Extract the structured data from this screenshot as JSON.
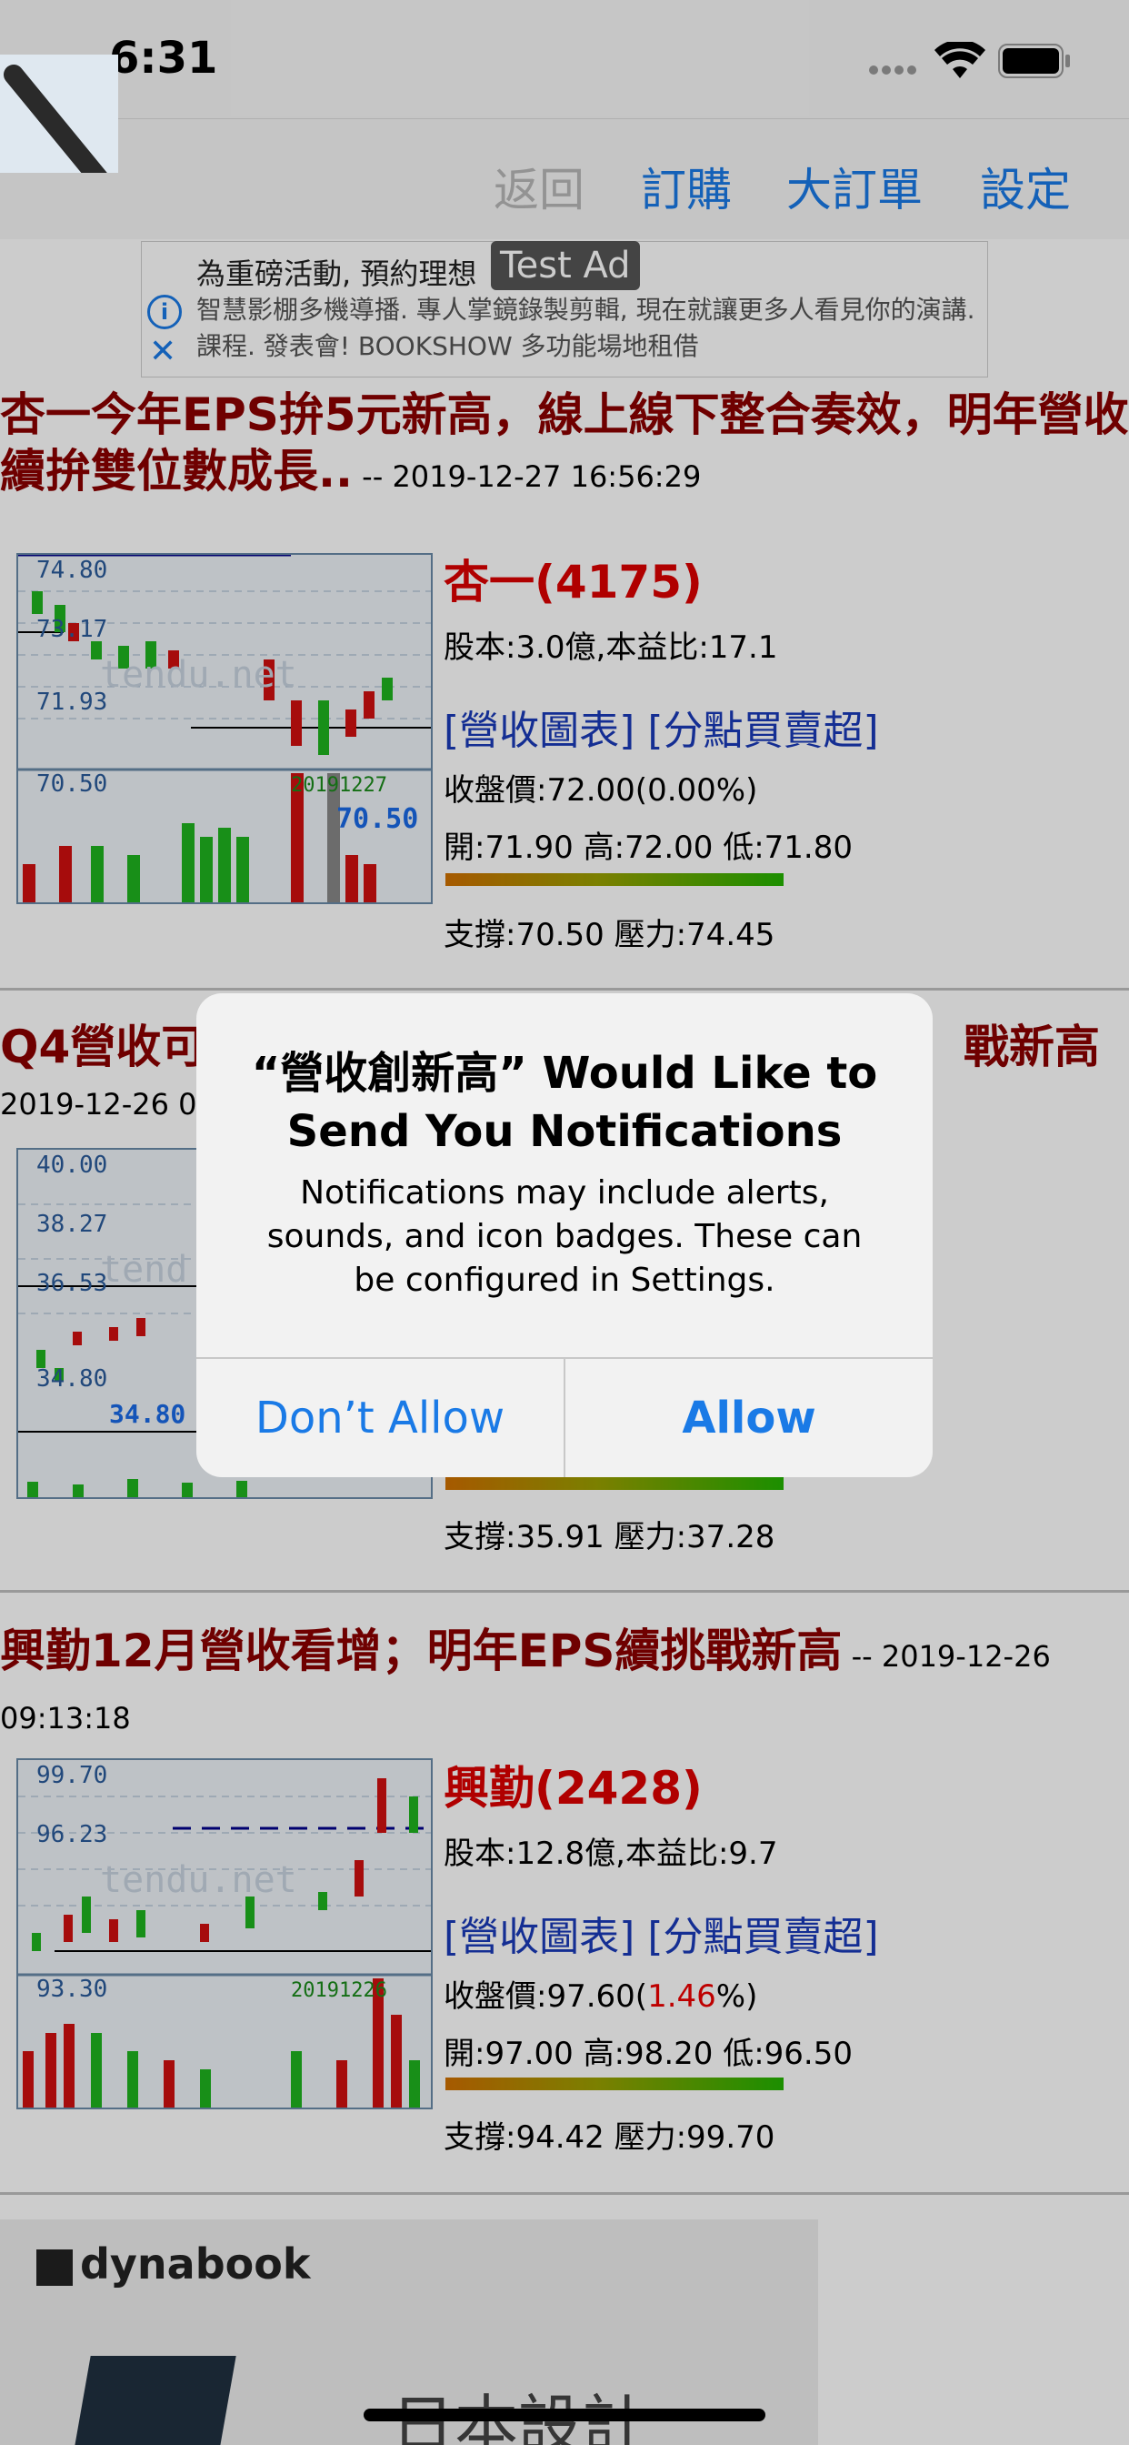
{
  "status_bar": {
    "time": "6:31"
  },
  "nav": {
    "back": "返回",
    "subscribe": "訂購",
    "big_orders": "大訂單",
    "settings": "設定"
  },
  "ad": {
    "title": "為重磅活動, 預約理想",
    "badge": "Test Ad",
    "body": "智慧影棚多機導播. 專人掌鏡錄製剪輯, 現在就讓更多人看見你的演講. 課程. 發表會! BOOKSHOW 多功能場地租借"
  },
  "articles": [
    {
      "headline": "杏一今年EPS拚5元新高，線上線下整合奏效，明年營收續拚雙位數成長..",
      "date": " -- 2019-12-27 16:56:29",
      "stock": "杏一(4175)",
      "capital": "股本:3.0億,本益比:17.1",
      "links": "[營收圖表] [分點買賣超]",
      "close_prefix": "收盤價:72.00(",
      "change": "0.00",
      "close_suffix": "%)",
      "ohl": "開:71.90 高:72.00 低:71.80",
      "support": "支撐:70.50 壓力:74.45",
      "chart_labels": [
        "74.80",
        "73.17",
        "71.93",
        "70.50",
        "20191227",
        "70.50",
        "tendu.net"
      ]
    },
    {
      "headline": "Q4營收可",
      "headline_end": "戰新高",
      "date": "2019-12-26 0",
      "support": "支撐:35.91 壓力:37.28",
      "chart_labels": [
        "40.00",
        "38.27",
        "36.53",
        "34.80",
        "34.80",
        "tend"
      ]
    },
    {
      "headline": "興勤12月營收看增；明年EPS續挑戰新高",
      "date": " -- 2019-12-26 09:13:18",
      "stock": "興勤(2428)",
      "capital": "股本:12.8億,本益比:9.7",
      "links": "[營收圖表] [分點買賣超]",
      "close_prefix": "收盤價:97.60(",
      "change": "1.46",
      "close_suffix": "%)",
      "ohl": "開:97.00 高:98.20 低:96.50",
      "support": "支撐:94.42 壓力:99.70",
      "chart_labels": [
        "99.70",
        "96.23",
        "93.30",
        "20191226",
        "tendu.net"
      ]
    }
  ],
  "bottom_ad": {
    "logo": "dynabook",
    "title": "日本設計"
  },
  "alert": {
    "title": "“營收創新高” Would Like to Send You Notifications",
    "message": "Notifications may include alerts, sounds, and icon badges. These can be configured in Settings.",
    "deny": "Don’t Allow",
    "allow": "Allow"
  }
}
